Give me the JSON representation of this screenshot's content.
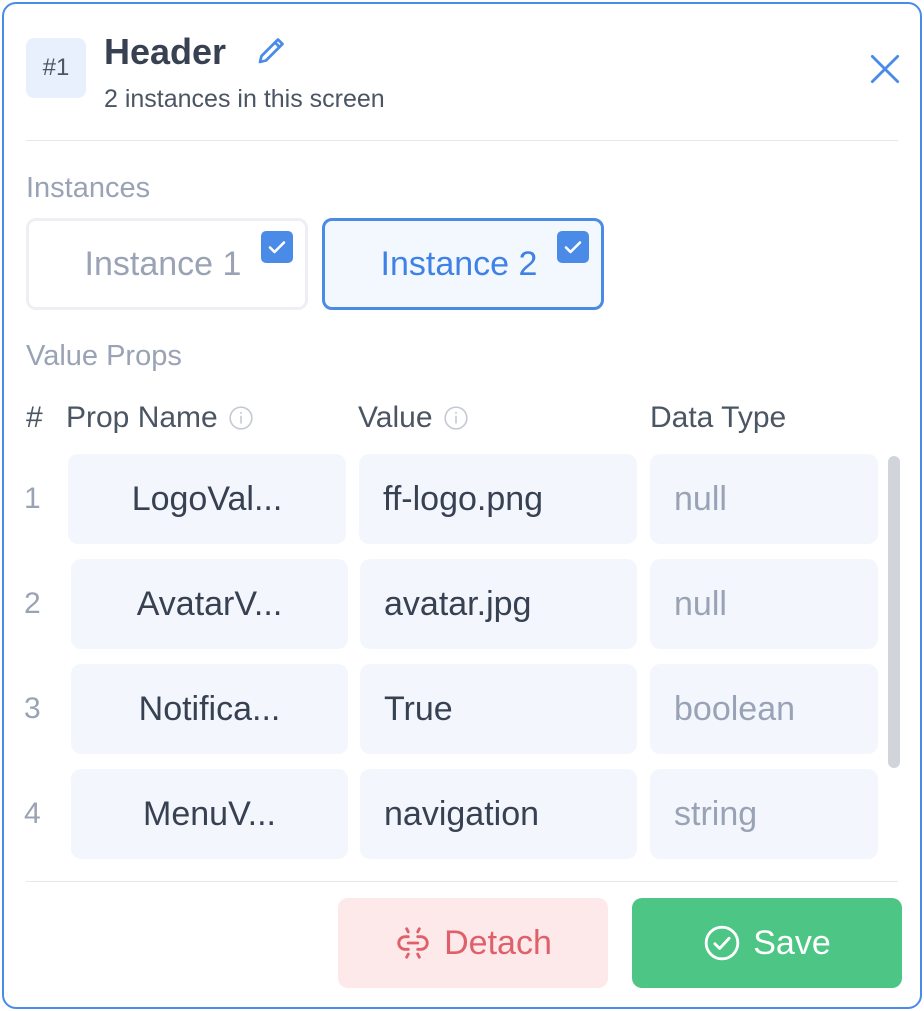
{
  "header": {
    "badge": "#1",
    "title": "Header",
    "subtitle": "2 instances in this screen"
  },
  "instances": {
    "label": "Instances",
    "items": [
      {
        "label": "Instance 1",
        "checked": true,
        "active": false
      },
      {
        "label": "Instance 2",
        "checked": true,
        "active": true
      }
    ]
  },
  "value_props": {
    "label": "Value Props",
    "columns": {
      "num": "#",
      "prop_name": "Prop Name",
      "value": "Value",
      "data_type": "Data Type"
    },
    "rows": [
      {
        "num": "1",
        "prop_name": "LogoVal...",
        "value": "ff-logo.png",
        "data_type": "null"
      },
      {
        "num": "2",
        "prop_name": "AvatarV...",
        "value": "avatar.jpg",
        "data_type": "null"
      },
      {
        "num": "3",
        "prop_name": "Notifica...",
        "value": "True",
        "data_type": "boolean"
      },
      {
        "num": "4",
        "prop_name": "MenuV...",
        "value": "navigation",
        "data_type": "string"
      }
    ]
  },
  "actions": {
    "detach_label": "Detach",
    "save_label": "Save"
  },
  "colors": {
    "accent": "#4a8be8",
    "save": "#4cc585",
    "detach_bg": "#fde8ea",
    "detach_text": "#e0606a"
  },
  "icons": {
    "edit": "pencil-icon",
    "close": "close-icon",
    "check": "checkbox-checked-icon",
    "info": "info-icon",
    "detach": "broken-link-icon",
    "save": "check-circle-icon"
  }
}
